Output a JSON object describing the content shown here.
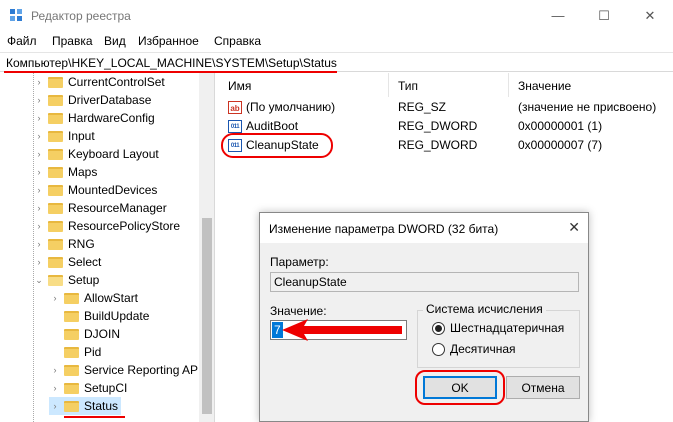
{
  "window": {
    "title": "Редактор реестра",
    "buttons": [
      "—",
      "☐",
      "✕"
    ]
  },
  "menu": [
    "Файл",
    "Правка",
    "Вид",
    "Избранное",
    "Справка"
  ],
  "address": "Компьютер\\HKEY_LOCAL_MACHINE\\SYSTEM\\Setup\\Status",
  "tree": {
    "items": [
      {
        "label": "CurrentControlSet"
      },
      {
        "label": "DriverDatabase"
      },
      {
        "label": "HardwareConfig"
      },
      {
        "label": "Input"
      },
      {
        "label": "Keyboard Layout"
      },
      {
        "label": "Maps"
      },
      {
        "label": "MountedDevices"
      },
      {
        "label": "ResourceManager"
      },
      {
        "label": "ResourcePolicyStore"
      },
      {
        "label": "RNG"
      },
      {
        "label": "Select"
      },
      {
        "label": "Setup"
      },
      {
        "label": "AllowStart"
      },
      {
        "label": "BuildUpdate"
      },
      {
        "label": "DJOIN"
      },
      {
        "label": "Pid"
      },
      {
        "label": "Service Reporting API"
      },
      {
        "label": "SetupCI"
      },
      {
        "label": "Status"
      }
    ]
  },
  "list": {
    "headers": {
      "name": "Имя",
      "type": "Тип",
      "value": "Значение"
    },
    "rows": [
      {
        "icon": "ab",
        "name": "(По умолчанию)",
        "type": "REG_SZ",
        "value": "(значение не присвоено)"
      },
      {
        "icon": "011\n110",
        "name": "AuditBoot",
        "type": "REG_DWORD",
        "value": "0x00000001 (1)"
      },
      {
        "icon": "011\n110",
        "name": "CleanupState",
        "type": "REG_DWORD",
        "value": "0x00000007 (7)"
      }
    ]
  },
  "dialog": {
    "title": "Изменение параметра DWORD (32 бита)",
    "close": "✕",
    "param_label": "Параметр:",
    "param_value": "CleanupState",
    "value_label": "Значение:",
    "value": "7",
    "base_group": "Система исчисления",
    "radio_hex": "Шестнадцатеричная",
    "radio_dec": "Десятичная",
    "ok": "OK",
    "cancel": "Отмена"
  },
  "colors": {
    "annotation": "#e00000",
    "selection": "#cce8ff",
    "accent": "#0078d7"
  }
}
